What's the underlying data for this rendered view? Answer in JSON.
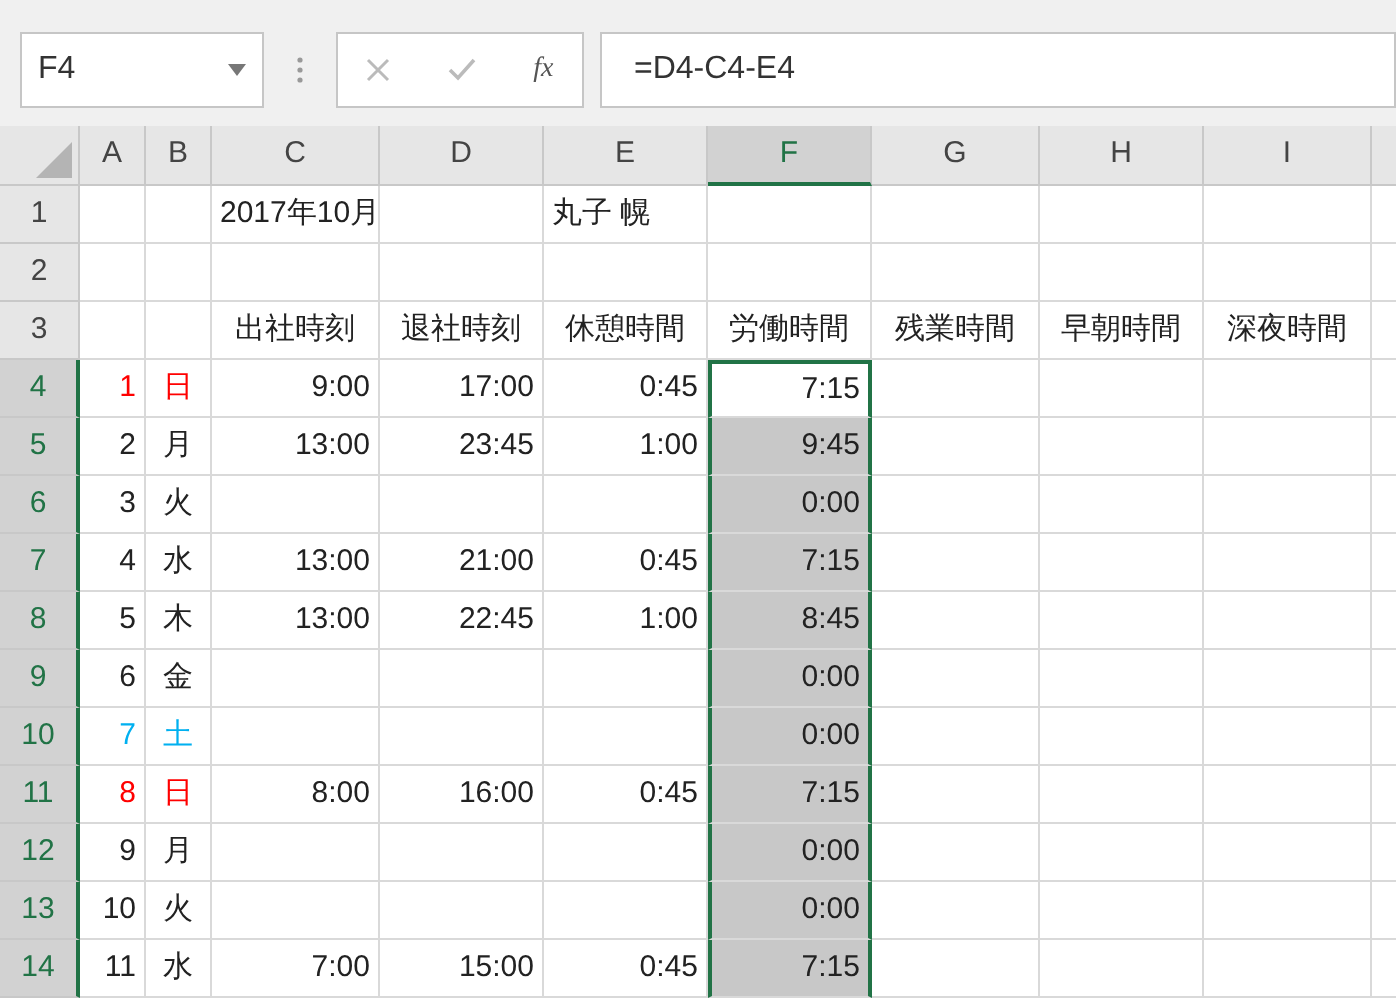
{
  "name_box": "F4",
  "fx_label": "fx",
  "formula": "=D4-C4-E4",
  "columns": [
    {
      "label": "A",
      "selected": false
    },
    {
      "label": "B",
      "selected": false
    },
    {
      "label": "C",
      "selected": false
    },
    {
      "label": "D",
      "selected": false
    },
    {
      "label": "E",
      "selected": false
    },
    {
      "label": "F",
      "selected": true
    },
    {
      "label": "G",
      "selected": false
    },
    {
      "label": "H",
      "selected": false
    },
    {
      "label": "I",
      "selected": false
    }
  ],
  "rows": [
    {
      "number": "1",
      "selected": false,
      "C": "2017年10月",
      "E": "丸子 幌"
    },
    {
      "number": "2",
      "selected": false
    },
    {
      "number": "3",
      "selected": false,
      "C": "出社時刻",
      "D": "退社時刻",
      "E": "休憩時間",
      "F": "労働時間",
      "G": "残業時間",
      "H": "早朝時間",
      "I": "深夜時間"
    },
    {
      "number": "4",
      "selected": true,
      "color": "#ff0000",
      "A": "1",
      "B": "日",
      "C": "9:00",
      "D": "17:00",
      "E": "0:45",
      "F": "7:15",
      "f_selected": false,
      "active": true
    },
    {
      "number": "5",
      "selected": true,
      "A": "2",
      "B": "月",
      "C": "13:00",
      "D": "23:45",
      "E": "1:00",
      "F": "9:45",
      "f_selected": true,
      "active": false
    },
    {
      "number": "6",
      "selected": true,
      "A": "3",
      "B": "火",
      "F": "0:00",
      "f_selected": true,
      "active": false
    },
    {
      "number": "7",
      "selected": true,
      "A": "4",
      "B": "水",
      "C": "13:00",
      "D": "21:00",
      "E": "0:45",
      "F": "7:15",
      "f_selected": true,
      "active": false
    },
    {
      "number": "8",
      "selected": true,
      "A": "5",
      "B": "木",
      "C": "13:00",
      "D": "22:45",
      "E": "1:00",
      "F": "8:45",
      "f_selected": true,
      "active": false
    },
    {
      "number": "9",
      "selected": true,
      "A": "6",
      "B": "金",
      "F": "0:00",
      "f_selected": true,
      "active": false
    },
    {
      "number": "10",
      "selected": true,
      "color": "#00b0f0",
      "A": "7",
      "B": "土",
      "F": "0:00",
      "f_selected": true,
      "active": false
    },
    {
      "number": "11",
      "selected": true,
      "color": "#ff0000",
      "A": "8",
      "B": "日",
      "C": "8:00",
      "D": "16:00",
      "E": "0:45",
      "F": "7:15",
      "f_selected": true,
      "active": false
    },
    {
      "number": "12",
      "selected": true,
      "A": "9",
      "B": "月",
      "F": "0:00",
      "f_selected": true,
      "active": false
    },
    {
      "number": "13",
      "selected": true,
      "A": "10",
      "B": "火",
      "F": "0:00",
      "f_selected": true,
      "active": false
    },
    {
      "number": "14",
      "selected": true,
      "A": "11",
      "B": "水",
      "C": "7:00",
      "D": "15:00",
      "E": "0:45",
      "F": "7:15",
      "f_selected": true,
      "active": false
    }
  ]
}
